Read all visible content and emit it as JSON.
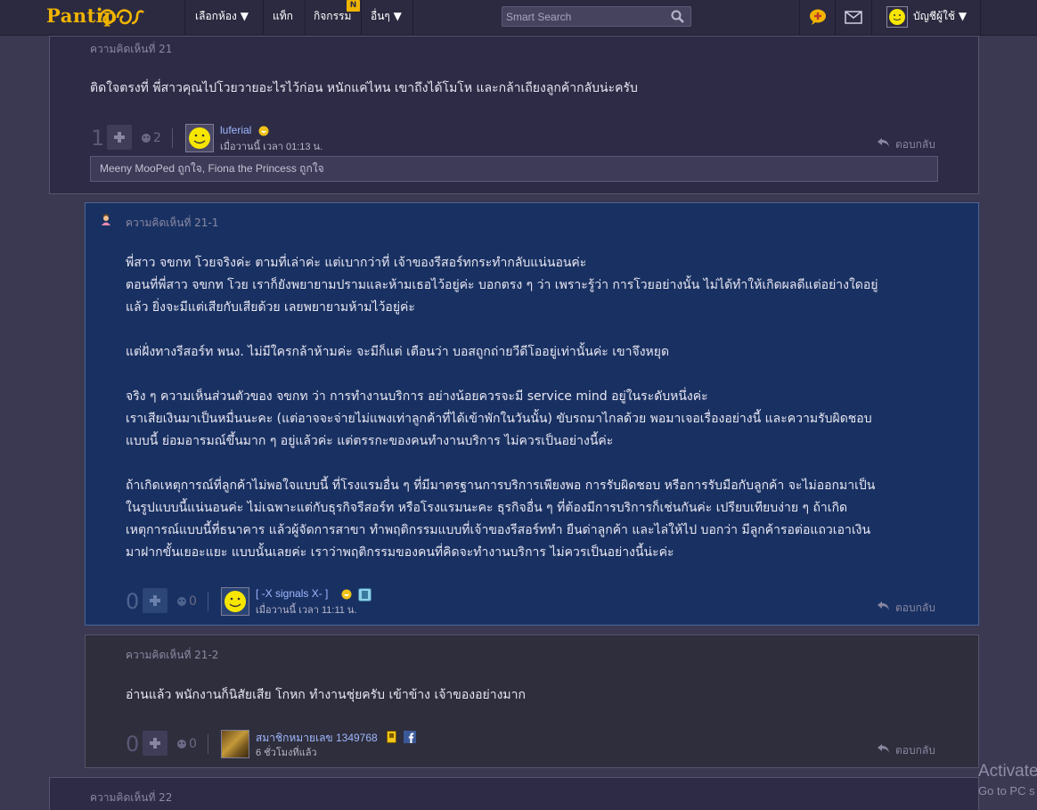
{
  "header": {
    "logo": "Pantip",
    "nav": [
      "เลือกห้อง ▼",
      "แท็ก",
      "กิจกรรม",
      "อื่นๆ ▼"
    ],
    "activity_badge": "N",
    "search_placeholder": "Smart Search",
    "account_label": "บัญชีผู้ใช้ ▼"
  },
  "comments": [
    {
      "title": "ความคิดเห็นที่ 21",
      "body": "ติดใจตรงที่ พี่สาวคุณไปโวยวายอะไรไว้ก่อน หนักแค่ไหน เขาถึงได้โมโห และกล้าเถียงลูกค้ากลับน่ะครับ",
      "votes": "1",
      "emotions": "2",
      "user": "luferial",
      "time": "เมื่อวานนี้ เวลา 01:13 น.",
      "reply": "ตอบกลับ",
      "likes": "Meeny MooPed ถูกใจ, Fiona the Princess ถูกใจ"
    },
    {
      "title": "ความคิดเห็นที่ 21-1",
      "body": [
        "พี่สาว จขกท โวยจริงค่ะ ตามที่เล่าค่ะ แต่เบากว่าที่ เจ้าของรีสอร์ทกระทำกลับแน่นอนค่ะ",
        "ตอนที่พี่สาว จขกท โวย เราก็ยังพยายามปรามและห้ามเธอไว้อยู่ค่ะ บอกตรง ๆ ว่า เพราะรู้ว่า การโวยอย่างนั้น ไม่ได้ทำให้เกิดผลดีแต่อย่างใดอยู่",
        "แล้ว ยิ่งจะมีแต่เสียกับเสียด้วย เลยพยายามห้ามไว้อยู่ค่ะ",
        "",
        "แต่ฝั่งทางรีสอร์ท พนง. ไม่มีใครกล้าห้ามค่ะ จะมีก็แต่ เตือนว่า บอสถูกถ่ายวีดีโออยู่เท่านั้นค่ะ เขาจึงหยุด",
        "",
        "จริง ๆ ความเห็นส่วนตัวของ จขกท ว่า การทำงานบริการ อย่างน้อยควรจะมี service mind อยู่ในระดับหนึ่งค่ะ",
        "เราเสียเงินมาเป็นหมื่นนะคะ (แต่อาจจะจ่ายไม่แพงเท่าลูกค้าที่ได้เข้าพักในวันนั้น) ขับรถมาไกลด้วย พอมาเจอเรื่องอย่างนี้ และความรับผิดชอบ",
        "แบบนี้ ย่อมอารมณ์ขึ้นมาก ๆ อยู่แล้วค่ะ แต่ตรรกะของคนทำงานบริการ ไม่ควรเป็นอย่างนี้ค่ะ",
        "",
        "ถ้าเกิดเหตุการณ์ที่ลูกค้าไม่พอใจแบบนี้ ที่โรงแรมอื่น ๆ ที่มีมาตรฐานการบริการเพียงพอ การรับผิดชอบ หรือการรับมือกับลูกค้า จะไม่ออกมาเป็น",
        "ในรูปแบบนี้แน่นอนค่ะ ไม่เฉพาะแต่กับธุรกิจรีสอร์ท หรือโรงแรมนะคะ ธุรกิจอื่น ๆ ที่ต้องมีการบริการก็เช่นกันค่ะ  เปรียบเทียบง่าย ๆ ถ้าเกิด",
        "เหตุการณ์แบบนี้ที่ธนาคาร แล้วผู้จัดการสาขา ทำพฤติกรรมแบบที่เจ้าของรีสอร์ททำ ยืนด่าลูกค้า และไล่ให้ไป บอกว่า มีลูกค้ารอต่อแถวเอาเงิน",
        "มาฝากขั้นเยอะแยะ แบบนั้นเลยค่ะ เราว่าพฤติกรรมของคนที่คิดจะทำงานบริการ ไม่ควรเป็นอย่างนี้น่ะค่ะ"
      ],
      "votes": "0",
      "emotions": "0",
      "user": "[ -X signals X- ]",
      "time": "เมื่อวานนี้ เวลา 11:11 น.",
      "reply": "ตอบกลับ"
    },
    {
      "title": "ความคิดเห็นที่ 21-2",
      "body": "อ่านแล้ว พนักงานก็นิสัยเสีย โกหก ทำงานชุ่ยครับ เข้าข้าง เจ้าของอย่างมาก",
      "votes": "0",
      "emotions": "0",
      "user": "สมาชิกหมายเลข 1349768",
      "time": "6 ชั่วโมงที่แล้ว",
      "reply": "ตอบกลับ"
    },
    {
      "title": "ความคิดเห็นที่ 22"
    }
  ],
  "watermark": {
    "line1": "Activate",
    "line2": "Go to PC s"
  }
}
